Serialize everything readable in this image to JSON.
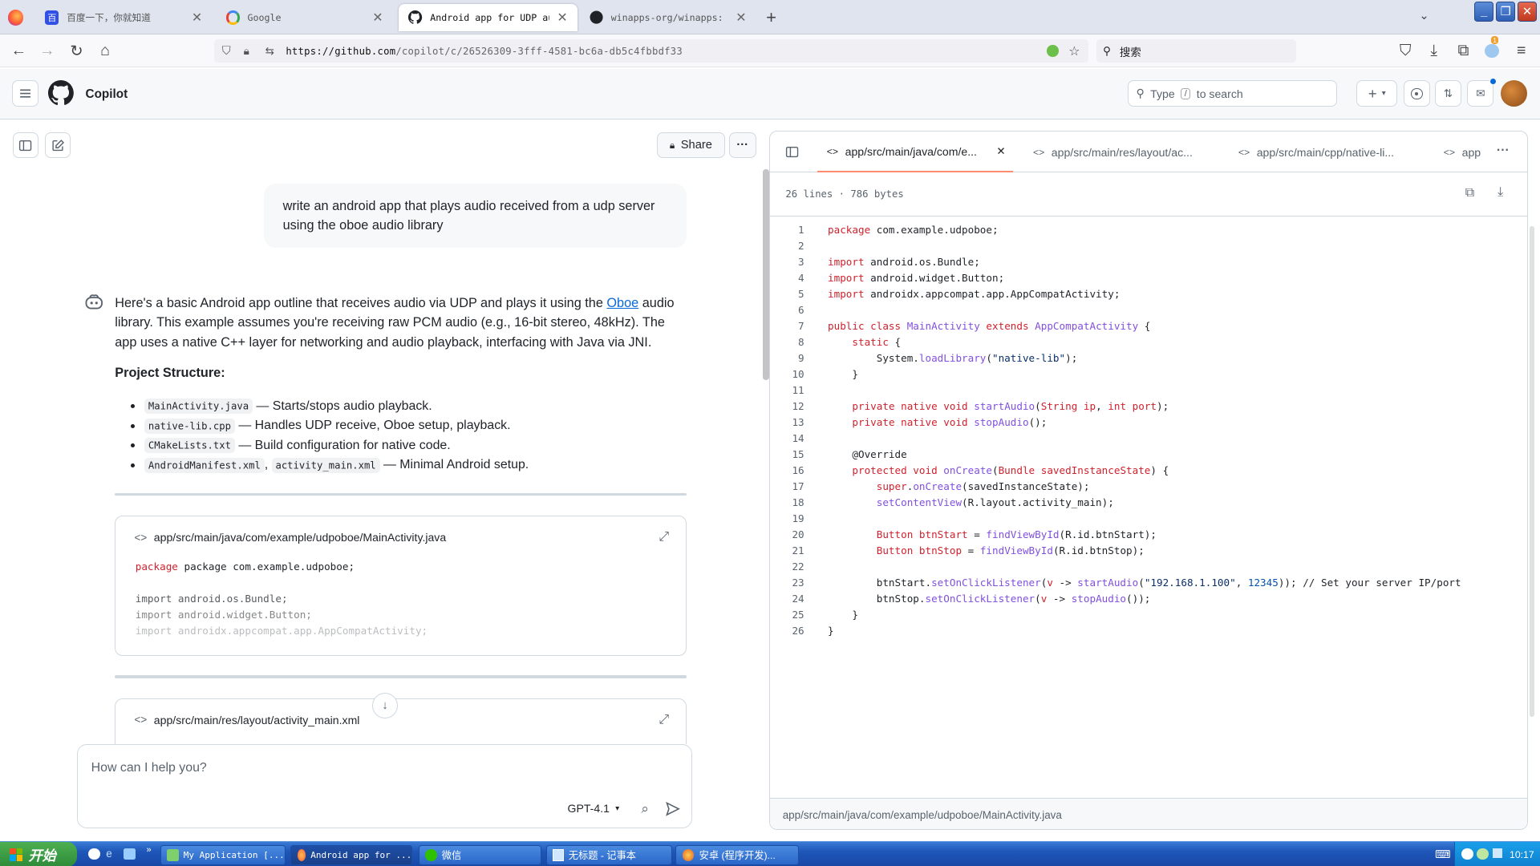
{
  "browser": {
    "tabs": [
      {
        "title": "百度一下，你就知道",
        "active": false
      },
      {
        "title": "Google",
        "active": false
      },
      {
        "title": "Android app for UDP audio pl",
        "active": true
      },
      {
        "title": "winapps-org/winapps: Run Wi",
        "active": false
      }
    ],
    "new_tab": "+",
    "url_host": "https://github.com",
    "url_path": "/copilot/c/26526309-3fff-4581-bc6a-db5c4fbbdf33",
    "search_placeholder": "搜索",
    "ext_badge": "1"
  },
  "header": {
    "title": "Copilot",
    "search_prefix": "Type",
    "search_key": "/",
    "search_suffix": "to search"
  },
  "chat": {
    "share_label": "Share",
    "user_message": "write an android app that plays audio received from a udp server using the oboe audio library",
    "intro_before": "Here's a basic Android app outline that receives audio via UDP and plays it using the ",
    "intro_link": "Oboe",
    "intro_after": " audio library. This example assumes you're receiving raw PCM audio (e.g., 16-bit stereo, 48kHz). The app uses a native C++ layer for networking and audio playback, interfacing with Java via JNI.",
    "structure_heading": "Project Structure:",
    "structure_items": [
      {
        "files": [
          "MainActivity.java"
        ],
        "desc": "— Starts/stops audio playback."
      },
      {
        "files": [
          "native-lib.cpp"
        ],
        "desc": "— Handles UDP receive, Oboe setup, playback."
      },
      {
        "files": [
          "CMakeLists.txt"
        ],
        "desc": "— Build configuration for native code."
      },
      {
        "files": [
          "AndroidManifest.xml",
          "activity_main.xml"
        ],
        "desc": "— Minimal Android setup."
      }
    ],
    "code_cards": [
      {
        "path": "app/src/main/java/com/example/udpoboe/MainActivity.java",
        "preview": [
          "package com.example.udpoboe;",
          "",
          "import android.os.Bundle;",
          "import android.widget.Button;",
          "import androidx.appcompat.app.AppCompatActivity;"
        ]
      },
      {
        "path": "app/src/main/res/layout/activity_main.xml",
        "preview": []
      }
    ],
    "composer_placeholder": "How can I help you?",
    "model": "GPT-4.1"
  },
  "panel": {
    "tabs": [
      {
        "label": "app/src/main/java/com/e...",
        "active": true
      },
      {
        "label": "app/src/main/res/layout/ac...",
        "active": false
      },
      {
        "label": "app/src/main/cpp/native-li...",
        "active": false
      },
      {
        "label": "app",
        "active": false
      }
    ],
    "meta_lines": "26 lines",
    "meta_sep": "·",
    "meta_size": "786 bytes",
    "footer_path": "app/src/main/java/com/example/udpoboe/MainActivity.java",
    "code": [
      [
        [
          "k",
          "package"
        ],
        [
          "c",
          " com.example.udpoboe;"
        ]
      ],
      [],
      [
        [
          "k",
          "import"
        ],
        [
          "c",
          " android.os.Bundle;"
        ]
      ],
      [
        [
          "k",
          "import"
        ],
        [
          "c",
          " android.widget.Button;"
        ]
      ],
      [
        [
          "k",
          "import"
        ],
        [
          "c",
          " androidx.appcompat.app.AppCompatActivity;"
        ]
      ],
      [],
      [
        [
          "k",
          "public class "
        ],
        [
          "f",
          "MainActivity"
        ],
        [
          "k",
          " extends "
        ],
        [
          "f",
          "AppCompatActivity"
        ],
        [
          "c",
          " {"
        ]
      ],
      [
        [
          "c",
          "    "
        ],
        [
          "k",
          "static"
        ],
        [
          "c",
          " {"
        ]
      ],
      [
        [
          "c",
          "        System."
        ],
        [
          "f",
          "loadLibrary"
        ],
        [
          "c",
          "("
        ],
        [
          "s",
          "\"native-lib\""
        ],
        [
          "c",
          ");"
        ]
      ],
      [
        [
          "c",
          "    }"
        ]
      ],
      [],
      [
        [
          "c",
          "    "
        ],
        [
          "k",
          "private native void "
        ],
        [
          "f",
          "startAudio"
        ],
        [
          "c",
          "("
        ],
        [
          "k",
          "String"
        ],
        [
          "c",
          " "
        ],
        [
          "k",
          "ip"
        ],
        [
          "c",
          ", "
        ],
        [
          "k",
          "int"
        ],
        [
          "c",
          " "
        ],
        [
          "k",
          "port"
        ],
        [
          "c",
          ");"
        ]
      ],
      [
        [
          "c",
          "    "
        ],
        [
          "k",
          "private native void "
        ],
        [
          "f",
          "stopAudio"
        ],
        [
          "c",
          "();"
        ]
      ],
      [],
      [
        [
          "c",
          "    @Override"
        ]
      ],
      [
        [
          "c",
          "    "
        ],
        [
          "k",
          "protected void "
        ],
        [
          "f",
          "onCreate"
        ],
        [
          "c",
          "("
        ],
        [
          "k",
          "Bundle"
        ],
        [
          "c",
          " "
        ],
        [
          "k",
          "savedInstanceState"
        ],
        [
          "c",
          ") {"
        ]
      ],
      [
        [
          "c",
          "        "
        ],
        [
          "k",
          "super"
        ],
        [
          "c",
          "."
        ],
        [
          "f",
          "onCreate"
        ],
        [
          "c",
          "(savedInstanceState);"
        ]
      ],
      [
        [
          "c",
          "        "
        ],
        [
          "f",
          "setContentView"
        ],
        [
          "c",
          "(R.layout.activity_main);"
        ]
      ],
      [],
      [
        [
          "c",
          "        "
        ],
        [
          "k",
          "Button"
        ],
        [
          "c",
          " "
        ],
        [
          "k",
          "btnStart"
        ],
        [
          "c",
          " = "
        ],
        [
          "f",
          "findViewById"
        ],
        [
          "c",
          "(R.id.btnStart);"
        ]
      ],
      [
        [
          "c",
          "        "
        ],
        [
          "k",
          "Button"
        ],
        [
          "c",
          " "
        ],
        [
          "k",
          "btnStop"
        ],
        [
          "c",
          " = "
        ],
        [
          "f",
          "findViewById"
        ],
        [
          "c",
          "(R.id.btnStop);"
        ]
      ],
      [],
      [
        [
          "c",
          "        btnStart."
        ],
        [
          "f",
          "setOnClickListener"
        ],
        [
          "c",
          "("
        ],
        [
          "k",
          "v"
        ],
        [
          "c",
          " -> "
        ],
        [
          "f",
          "startAudio"
        ],
        [
          "c",
          "("
        ],
        [
          "s",
          "\"192.168.1.100\""
        ],
        [
          "c",
          ", "
        ],
        [
          "n",
          "12345"
        ],
        [
          "c",
          "));"
        ],
        [
          "c",
          " // Set your server IP/port"
        ]
      ],
      [
        [
          "c",
          "        btnStop."
        ],
        [
          "f",
          "setOnClickListener"
        ],
        [
          "c",
          "("
        ],
        [
          "k",
          "v"
        ],
        [
          "c",
          " -> "
        ],
        [
          "f",
          "stopAudio"
        ],
        [
          "c",
          "());"
        ]
      ],
      [
        [
          "c",
          "    }"
        ]
      ],
      [
        [
          "c",
          "}"
        ]
      ]
    ]
  },
  "taskbar": {
    "start": "开始",
    "items": [
      {
        "label": "My Application [...",
        "active": false
      },
      {
        "label": "Android app for ...",
        "active": true
      },
      {
        "label": "微信",
        "active": false
      },
      {
        "label": "无标题 - 记事本",
        "active": false
      },
      {
        "label": "安卓 (程序开发)...",
        "active": false
      }
    ],
    "clock": "10:17"
  }
}
